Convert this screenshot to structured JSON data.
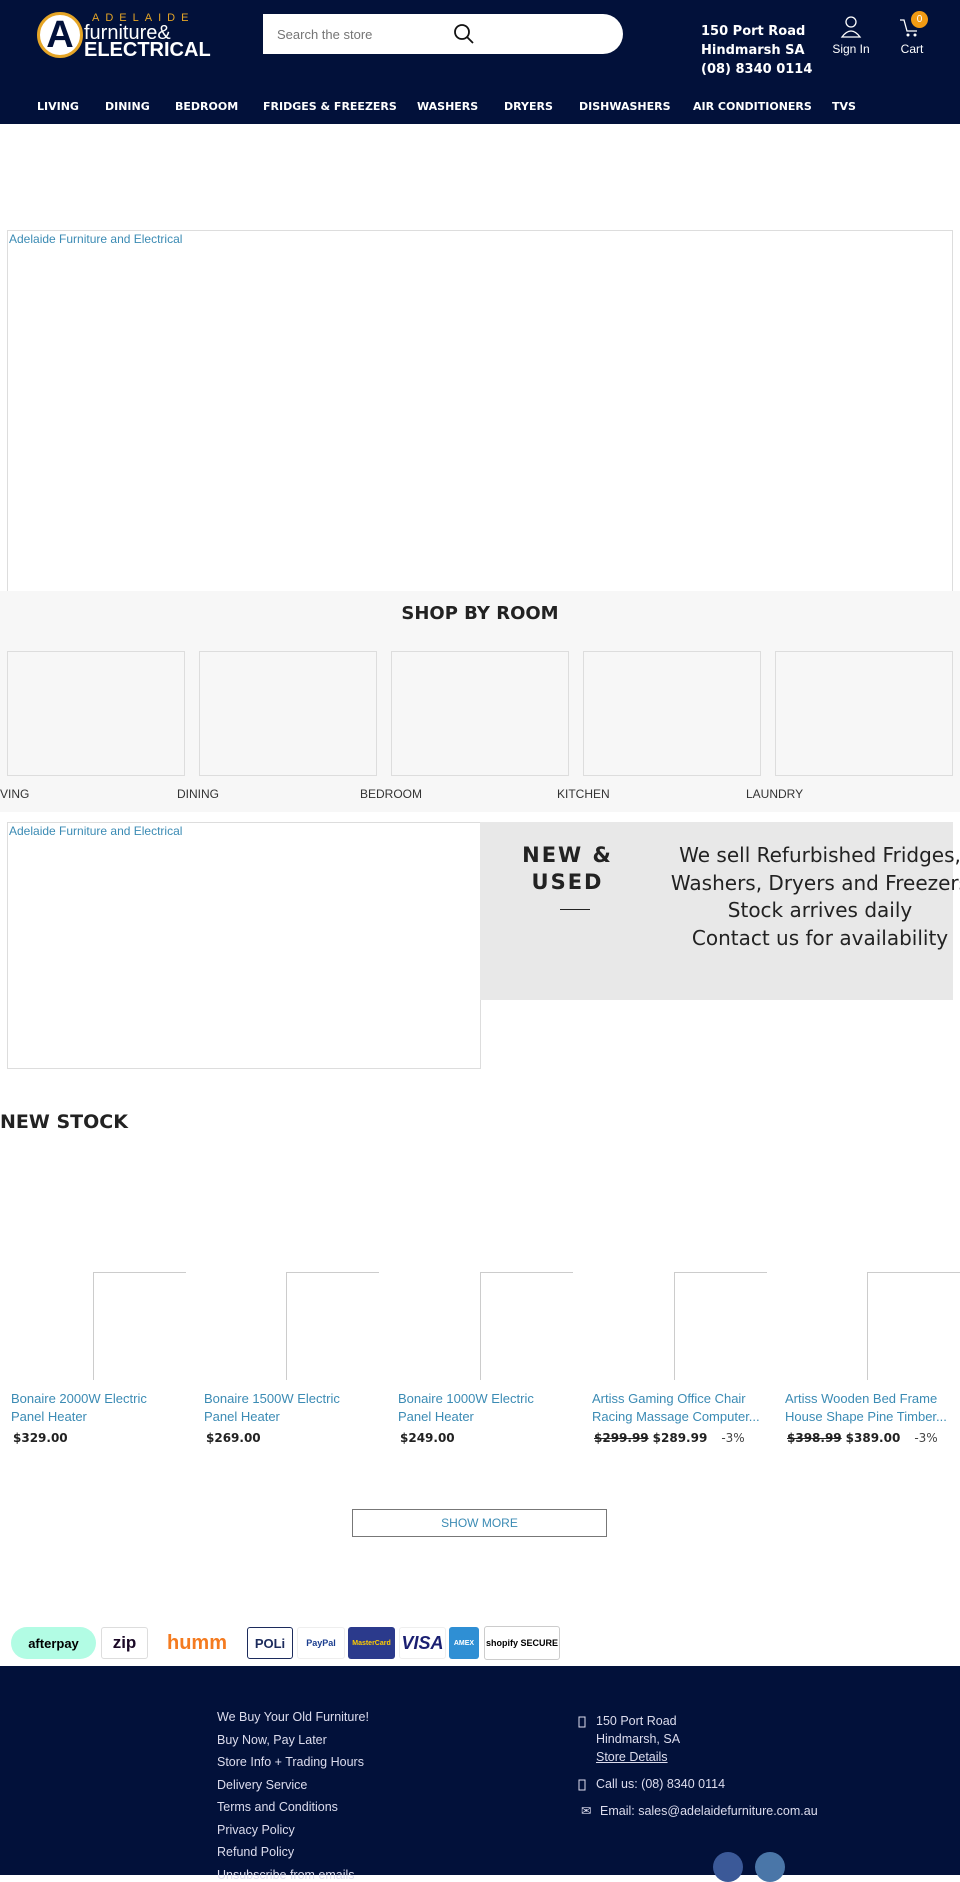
{
  "header": {
    "logo_text": [
      "ADELAIDE",
      "furniture&",
      "ELECTRICAL"
    ],
    "logo_letter": "A",
    "search_placeholder": "Search the store",
    "address": [
      "150 Port Road",
      "Hindmarsh SA",
      "(08) 8340 0114"
    ],
    "sign_in": "Sign In",
    "cart": "Cart",
    "cart_count": "0",
    "colors": {
      "bg": "#02113a",
      "accent": "#e5a526",
      "badge": "#f29b13"
    }
  },
  "nav": [
    "LIVING",
    "DINING",
    "BEDROOM",
    "FRIDGES & FREEZERS",
    "WASHERS",
    "DRYERS",
    "DISHWASHERS",
    "AIR CONDITIONERS",
    "TVS"
  ],
  "hero": {
    "alt": "Adelaide Furniture and Electrical"
  },
  "shop_by_room": {
    "title": "SHOP BY ROOM",
    "rooms": [
      "VING",
      "DINING",
      "BEDROOM",
      "KITCHEN",
      "LAUNDRY"
    ]
  },
  "new_used": {
    "image_alt": "Adelaide Furniture and Electrical",
    "title_line1": "NEW &",
    "title_line2": "USED",
    "lines": [
      "We sell Refurbished Fridges,",
      "Washers, Dryers and Freezers",
      "Stock arrives daily",
      "Contact us for availability"
    ]
  },
  "new_stock": {
    "title": "NEW STOCK",
    "products": [
      {
        "title1": "Bonaire 2000W Electric",
        "title2": "Panel Heater",
        "old": "",
        "price": "$329.00",
        "discount": ""
      },
      {
        "title1": "Bonaire 1500W Electric",
        "title2": "Panel Heater",
        "old": "",
        "price": "$269.00",
        "discount": ""
      },
      {
        "title1": "Bonaire 1000W Electric",
        "title2": "Panel Heater",
        "old": "",
        "price": "$249.00",
        "discount": ""
      },
      {
        "title1": "Artiss Gaming Office Chair",
        "title2": "Racing Massage Computer...",
        "old": "$299.99",
        "price": "$289.99",
        "discount": "-3%"
      },
      {
        "title1": "Artiss Wooden Bed Frame",
        "title2": "House Shape Pine Timber...",
        "old": "$398.99",
        "price": "$389.00",
        "discount": "-3%"
      }
    ],
    "show_more": "SHOW MORE"
  },
  "payments": [
    "afterpay",
    "zip",
    "humm",
    "POLi",
    "PayPal",
    "MasterCard",
    "VISA",
    "AMEX",
    "shopify SECURE"
  ],
  "footer": {
    "links": [
      "We Buy Your Old Furniture!",
      "Buy Now, Pay Later",
      "Store Info + Trading Hours",
      "Delivery Service",
      "Terms and Conditions",
      "Privacy Policy",
      "Refund Policy",
      "Unsubscribe from emails"
    ],
    "address": [
      "150 Port Road",
      "Hindmarsh, SA"
    ],
    "store_details": "Store Details",
    "call": "Call us: (08) 8340 0114",
    "email": "Email: sales@adelaidefurniture.com.au"
  }
}
